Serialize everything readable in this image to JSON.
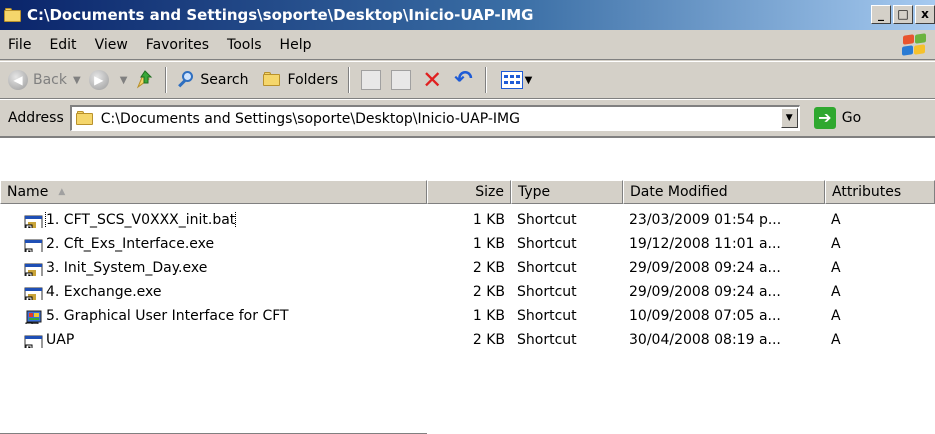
{
  "window": {
    "title": "C:\\Documents and Settings\\soporte\\Desktop\\Inicio-UAP-IMG",
    "controls": {
      "minimize": "_",
      "maximize": "□",
      "close": "x"
    }
  },
  "menu": [
    {
      "label": "File"
    },
    {
      "label": "Edit"
    },
    {
      "label": "View"
    },
    {
      "label": "Favorites"
    },
    {
      "label": "Tools"
    },
    {
      "label": "Help"
    }
  ],
  "toolbar": {
    "back_label": "Back",
    "search_label": "Search",
    "folders_label": "Folders"
  },
  "address": {
    "label": "Address",
    "value": "C:\\Documents and Settings\\soporte\\Desktop\\Inicio-UAP-IMG",
    "go_label": "Go"
  },
  "columns": {
    "name": "Name",
    "size": "Size",
    "type": "Type",
    "date": "Date Modified",
    "attributes": "Attributes"
  },
  "files": [
    {
      "name": "1. CFT_SCS_V0XXX_init.bat",
      "size": "1 KB",
      "type": "Shortcut",
      "date": "23/03/2009 01:54 p...",
      "attr": "A",
      "icon": "batch-shortcut-icon"
    },
    {
      "name": "2. Cft_Exs_Interface.exe",
      "size": "1 KB",
      "type": "Shortcut",
      "date": "19/12/2008 11:01 a...",
      "attr": "A",
      "icon": "exe-shortcut-icon"
    },
    {
      "name": "3. Init_System_Day.exe",
      "size": "2 KB",
      "type": "Shortcut",
      "date": "29/09/2008 09:24 a...",
      "attr": "A",
      "icon": "batch-shortcut-icon"
    },
    {
      "name": "4. Exchange.exe",
      "size": "2 KB",
      "type": "Shortcut",
      "date": "29/09/2008 09:24 a...",
      "attr": "A",
      "icon": "batch-shortcut-icon"
    },
    {
      "name": "5. Graphical User Interface for CFT",
      "size": "1 KB",
      "type": "Shortcut",
      "date": "10/09/2008 07:05 a...",
      "attr": "A",
      "icon": "app-shortcut-icon"
    },
    {
      "name": "UAP",
      "size": "2 KB",
      "type": "Shortcut",
      "date": "30/04/2008 08:19 a...",
      "attr": "A",
      "icon": "exe-shortcut-icon"
    }
  ]
}
